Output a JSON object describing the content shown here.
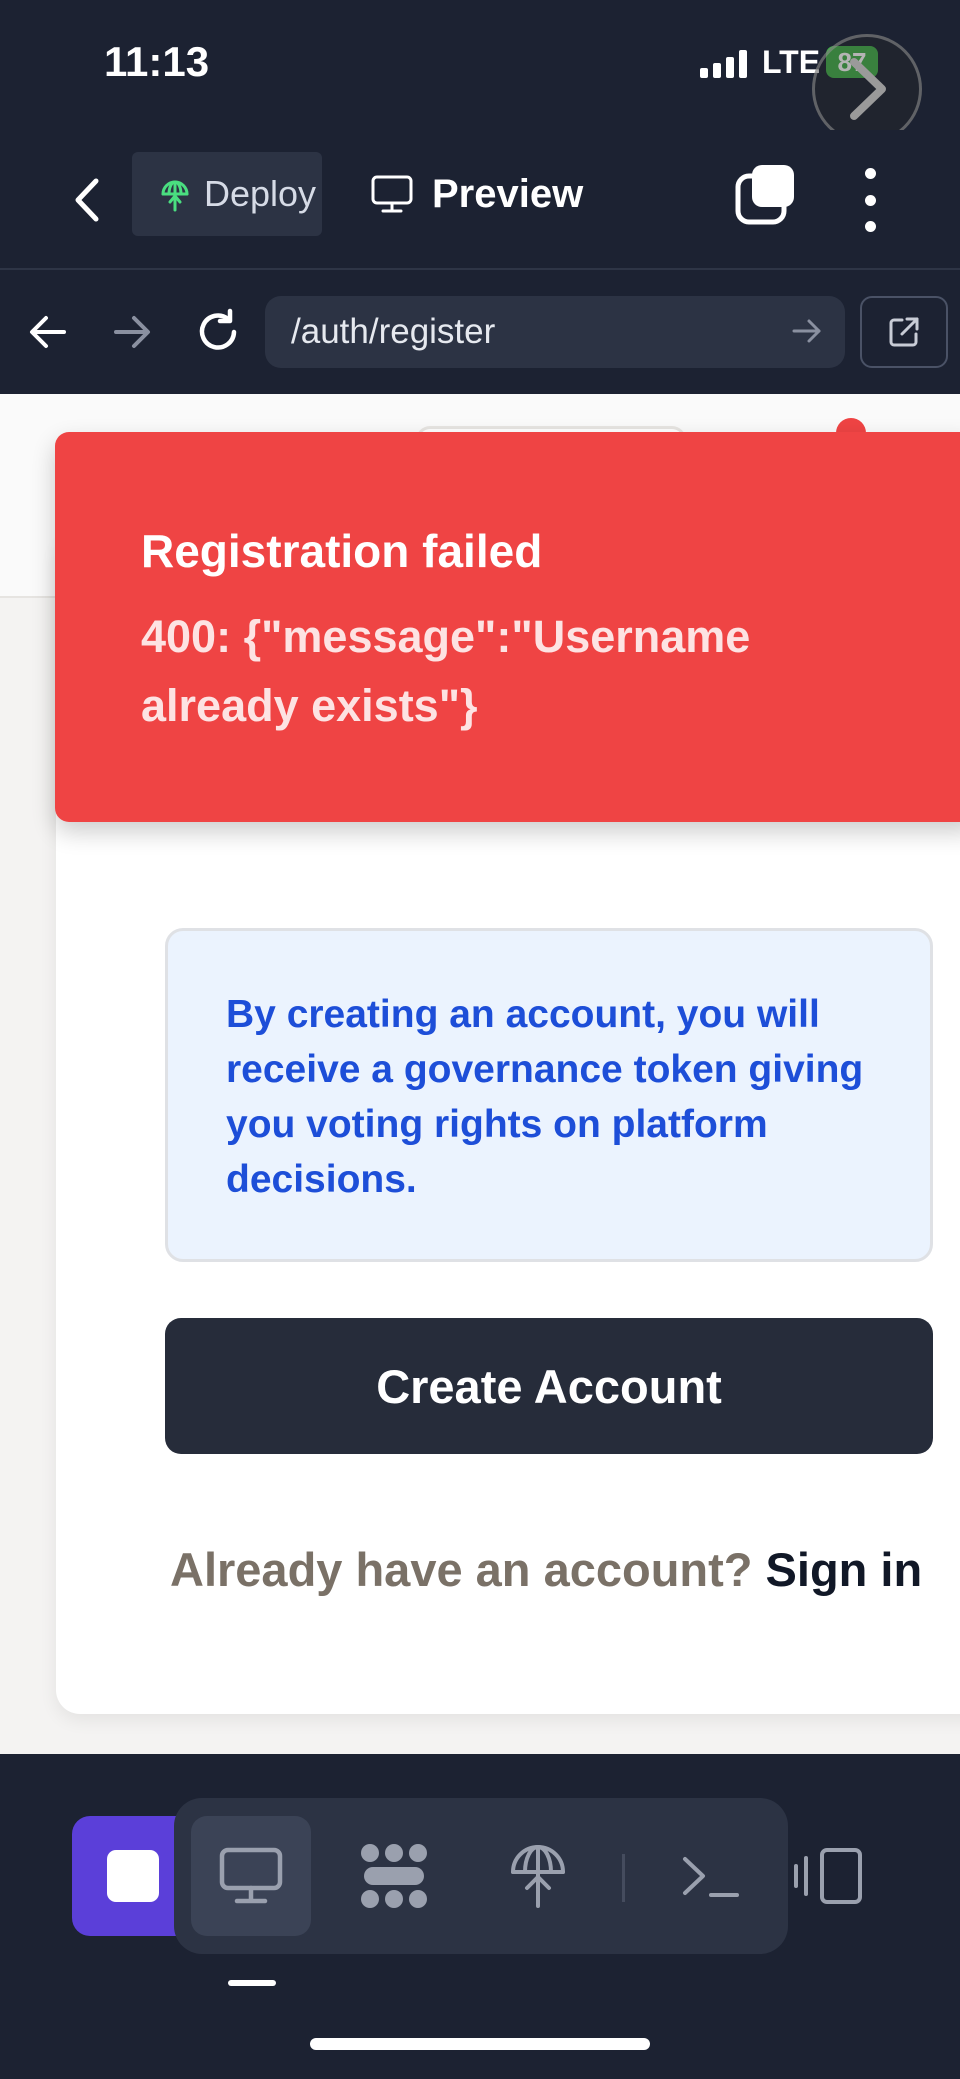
{
  "status_bar": {
    "time": "11:13",
    "network": "LTE",
    "battery": "87"
  },
  "toolbar": {
    "deploy_label": "Deploy",
    "preview_label": "Preview"
  },
  "browser": {
    "url": "/auth/register"
  },
  "toast": {
    "title": "Registration failed",
    "message": "400: {\"message\":\"Username already exists\"}"
  },
  "form": {
    "info_text": "By creating an account, you will receive a governance token giving you voting rights on platform decisions.",
    "create_button": "Create Account",
    "signin_prompt": "Already have an account?",
    "signin_link": "Sign in"
  },
  "colors": {
    "toast_bg": "#ef4444",
    "info_text": "#1d4ed8",
    "info_bg": "#ebf3fe",
    "primary_button": "#262c3a",
    "stop_button": "#5b3fd9",
    "deploy_icon": "#4ade80"
  },
  "icons": {
    "toolbar": [
      "back-chevron-icon",
      "deploy-icon",
      "monitor-icon",
      "windows-icon",
      "more-vertical-icon"
    ],
    "browser": [
      "arrow-left-icon",
      "arrow-right-icon",
      "refresh-icon",
      "go-arrow-icon",
      "external-link-icon"
    ],
    "dock": [
      "stop-icon",
      "monitor-icon",
      "agents-icon",
      "deploy-icon",
      "terminal-icon",
      "devices-icon"
    ]
  }
}
